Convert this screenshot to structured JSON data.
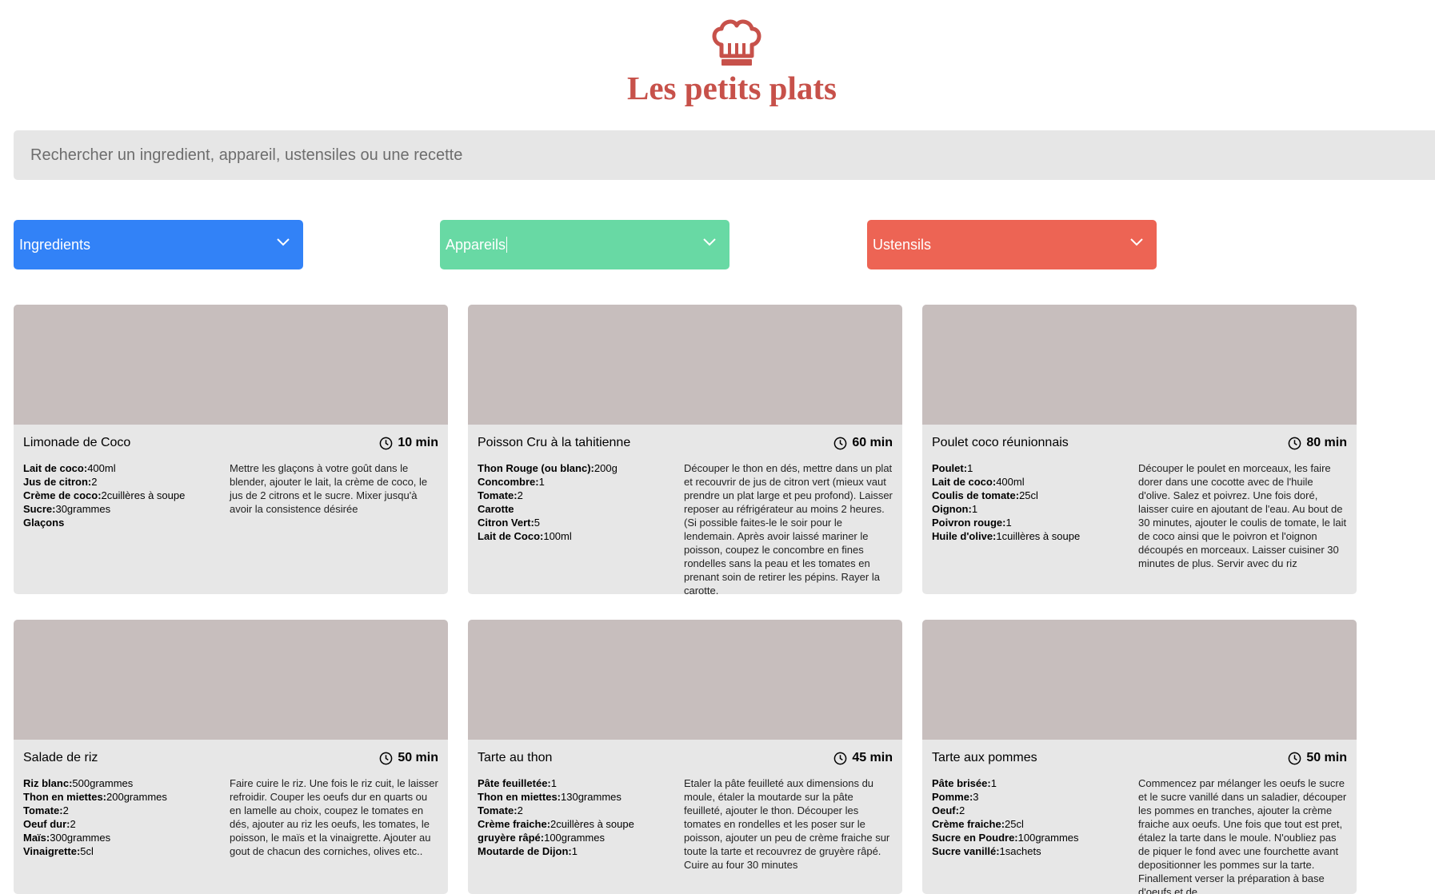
{
  "header": {
    "logo_icon": "chef-hat-icon",
    "title": "Les petits plats"
  },
  "search": {
    "placeholder": "Rechercher un ingredient, appareil, ustensiles ou une recette",
    "value": ""
  },
  "filters": [
    {
      "label": "Ingredients",
      "color": "#3282f7",
      "icon": "chevron-down-icon"
    },
    {
      "label": "Appareils",
      "color": "#68d9a4",
      "icon": "chevron-down-icon"
    },
    {
      "label": "Ustensils",
      "color": "#ed6454",
      "icon": "chevron-down-icon"
    }
  ],
  "recipes": [
    {
      "name": "Limonade de Coco",
      "time": "10 min",
      "ingredients": [
        {
          "name": "Lait de coco:",
          "qty": "400ml"
        },
        {
          "name": "Jus de citron:",
          "qty": "2"
        },
        {
          "name": "Crème de coco:",
          "qty": "2cuillères à soupe"
        },
        {
          "name": "Sucre:",
          "qty": "30grammes"
        },
        {
          "name": "Glaçons",
          "qty": ""
        }
      ],
      "description": "Mettre les glaçons à votre goût dans le blender, ajouter le lait, la crème de coco, le jus de 2 citrons et le sucre. Mixer jusqu'à avoir la consistence désirée"
    },
    {
      "name": "Poisson Cru à la tahitienne",
      "time": "60 min",
      "ingredients": [
        {
          "name": "Thon Rouge (ou blanc):",
          "qty": "200g"
        },
        {
          "name": "Concombre:",
          "qty": "1"
        },
        {
          "name": "Tomate:",
          "qty": "2"
        },
        {
          "name": "Carotte",
          "qty": ""
        },
        {
          "name": "Citron Vert:",
          "qty": "5"
        },
        {
          "name": "Lait de Coco:",
          "qty": "100ml"
        }
      ],
      "description": "Découper le thon en dés, mettre dans un plat et recouvrir de jus de citron vert (mieux vaut prendre un plat large et peu profond). Laisser reposer au réfrigérateur au moins 2 heures. (Si possible faites-le le soir pour le lendemain. Après avoir laissé mariner le poisson, coupez le concombre en fines rondelles sans la peau et les tomates en prenant soin de retirer les pépins. Rayer la carotte."
    },
    {
      "name": "Poulet coco réunionnais",
      "time": "80 min",
      "ingredients": [
        {
          "name": "Poulet:",
          "qty": "1"
        },
        {
          "name": "Lait de coco:",
          "qty": "400ml"
        },
        {
          "name": "Coulis de tomate:",
          "qty": "25cl"
        },
        {
          "name": "Oignon:",
          "qty": "1"
        },
        {
          "name": "Poivron rouge:",
          "qty": "1"
        },
        {
          "name": "Huile d'olive:",
          "qty": "1cuillères à soupe"
        }
      ],
      "description": "Découper le poulet en morceaux, les faire dorer dans une cocotte avec de l'huile d'olive. Salez et poivrez. Une fois doré, laisser cuire en ajoutant de l'eau. Au bout de 30 minutes, ajouter le coulis de tomate, le lait de coco ainsi que le poivron et l'oignon découpés en morceaux. Laisser cuisiner 30 minutes de plus. Servir avec du riz"
    },
    {
      "name": "Salade de riz",
      "time": "50 min",
      "ingredients": [
        {
          "name": "Riz blanc:",
          "qty": "500grammes"
        },
        {
          "name": "Thon en miettes:",
          "qty": "200grammes"
        },
        {
          "name": "Tomate:",
          "qty": "2"
        },
        {
          "name": "Oeuf dur:",
          "qty": "2"
        },
        {
          "name": "Maïs:",
          "qty": "300grammes"
        },
        {
          "name": "Vinaigrette:",
          "qty": "5cl"
        }
      ],
      "description": "Faire cuire le riz. Une fois le riz cuit, le laisser refroidir. Couper les oeufs dur en quarts ou en lamelle au choix, coupez le tomates en dés, ajouter au riz les oeufs, les tomates, le poisson, le maïs et la vinaigrette. Ajouter au gout de chacun des corniches, olives etc.."
    },
    {
      "name": "Tarte au thon",
      "time": "45 min",
      "ingredients": [
        {
          "name": "Pâte feuilletée:",
          "qty": "1"
        },
        {
          "name": "Thon en miettes:",
          "qty": "130grammes"
        },
        {
          "name": "Tomate:",
          "qty": "2"
        },
        {
          "name": "Crème fraiche:",
          "qty": "2cuillères à soupe"
        },
        {
          "name": "gruyère râpé:",
          "qty": "100grammes"
        },
        {
          "name": "Moutarde de Dijon:",
          "qty": "1"
        }
      ],
      "description": "Etaler la pâte feuilleté aux dimensions du moule, étaler la moutarde sur la pâte feuilleté, ajouter le thon. Découper les tomates en rondelles et les poser sur le poisson, ajouter un peu de crème fraiche sur toute la tarte et recouvrez de gruyère râpé. Cuire au four 30 minutes"
    },
    {
      "name": "Tarte aux pommes",
      "time": "50 min",
      "ingredients": [
        {
          "name": "Pâte brisée:",
          "qty": "1"
        },
        {
          "name": "Pomme:",
          "qty": "3"
        },
        {
          "name": "Oeuf:",
          "qty": "2"
        },
        {
          "name": "Crème fraiche:",
          "qty": "25cl"
        },
        {
          "name": "Sucre en Poudre:",
          "qty": "100grammes"
        },
        {
          "name": "Sucre vanillé:",
          "qty": "1sachets"
        }
      ],
      "description": "Commencez par mélanger les oeufs le sucre et le sucre vanillé dans un saladier, découper les pommes en tranches, ajouter la crème fraiche aux oeufs. Une fois que tout est pret, étalez la tarte dans le moule. N'oubliez pas de piquer le fond avec une fourchette avant depositionner les pommes sur la tarte. Finallement verser la préparation à base d'oeufs et de"
    }
  ]
}
